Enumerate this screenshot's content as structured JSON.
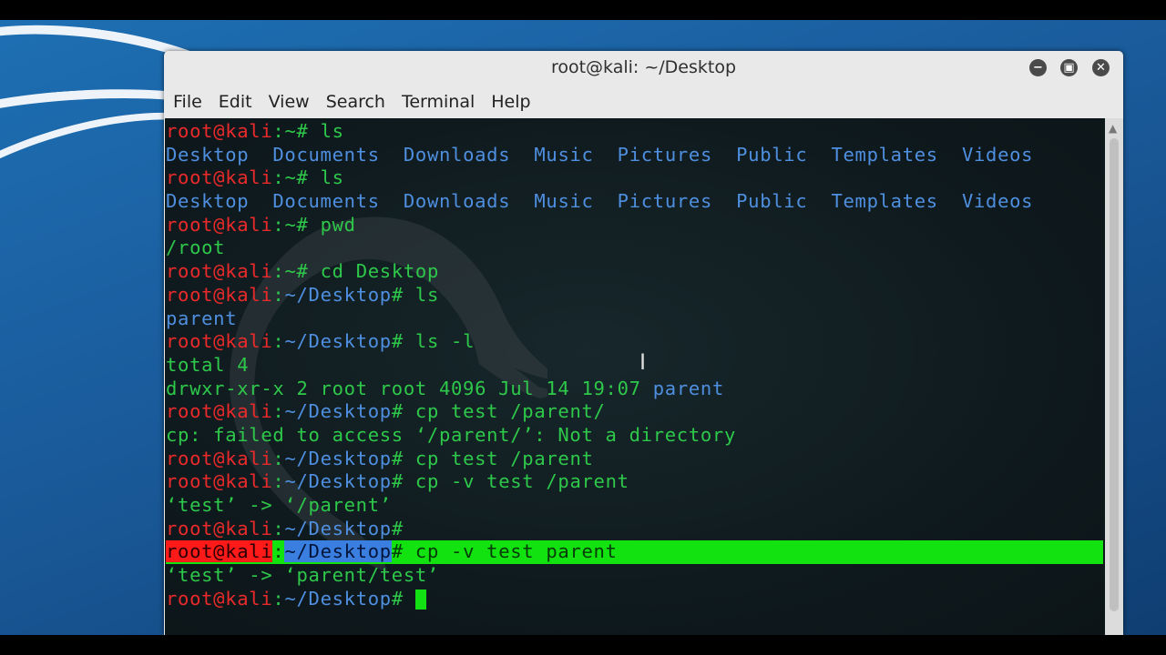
{
  "window": {
    "title": "root@kali: ~/Desktop",
    "controls": [
      "−",
      "▣",
      "✕"
    ]
  },
  "menu": [
    "File",
    "Edit",
    "View",
    "Search",
    "Terminal",
    "Help"
  ],
  "prompt": {
    "user": "root@kali",
    "sep": ":",
    "home": "~",
    "desktop": "~/Desktop",
    "hash": "#"
  },
  "dirs": [
    "Desktop",
    "Documents",
    "Downloads",
    "Music",
    "Pictures",
    "Public",
    "Templates",
    "Videos"
  ],
  "terminal": {
    "cmd_ls": "ls",
    "cmd_pwd": "pwd",
    "out_pwd": "/root",
    "cmd_cd": "cd Desktop",
    "out_ls_desktop": "parent",
    "cmd_ls_l": "ls -l",
    "out_total": "total 4",
    "out_perm": "drwxr-xr-x 2 root root 4096 Jul 14 19:07 ",
    "out_perm_dir": "parent",
    "cmd_cp1": "cp test /parent/",
    "out_cp1": "cp: failed to access ‘/parent/’: Not a directory",
    "cmd_cp2": "cp test /parent",
    "cmd_cp3": "cp -v test /parent",
    "out_cp3": "‘test’ -> ‘/parent’",
    "cmd_cp4": "cp -v test parent",
    "out_cp4": "‘test’ -> ‘parent/test’"
  },
  "colors": {
    "prompt_user": "#ea2a2a",
    "prompt_path": "#4f8fe0",
    "text": "#2ec84a",
    "highlight": "#12e20f"
  }
}
